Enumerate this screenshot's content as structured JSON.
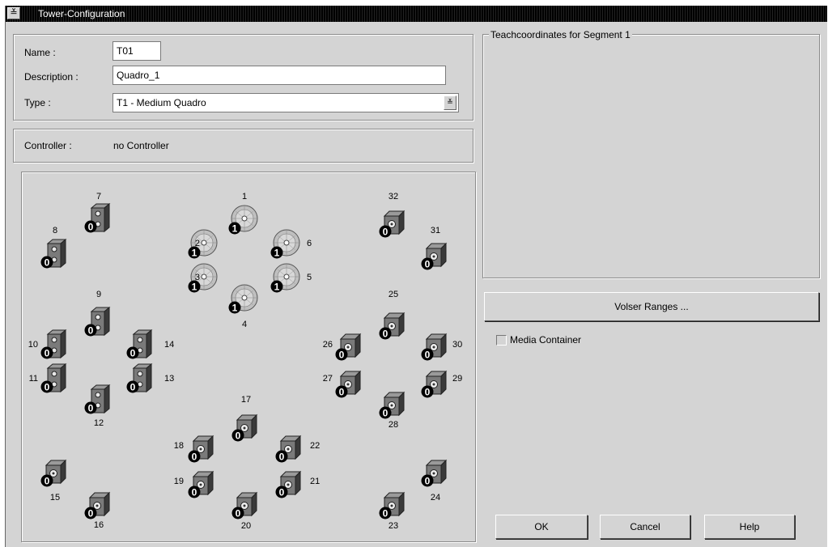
{
  "window": {
    "title": "Tower-Configuration",
    "sysmenu_glyph": "≚"
  },
  "form": {
    "name_label": "Name :",
    "name_value": "T01",
    "description_label": "Description :",
    "description_value": "Quadro_1",
    "type_label": "Type :",
    "type_value": "T1  - Medium Quadro",
    "combo_glyph": "≚"
  },
  "controller": {
    "label": "Controller :",
    "value": "no Controller"
  },
  "teach": {
    "legend": "Teachcoordinates for Segment 1"
  },
  "buttons": {
    "volser": "Volser Ranges ...",
    "ok": "OK",
    "cancel": "Cancel",
    "help": "Help"
  },
  "media_container": {
    "label": "Media Container",
    "checked": false
  },
  "icons": {
    "tape": "tape-drive-icon",
    "cd": "optical-disc-drive-icon"
  },
  "slots": [
    {
      "num": "1",
      "kind": "cd",
      "badge": "1"
    },
    {
      "num": "2",
      "kind": "cd",
      "badge": "1"
    },
    {
      "num": "3",
      "kind": "cd",
      "badge": "1"
    },
    {
      "num": "4",
      "kind": "cd",
      "badge": "1"
    },
    {
      "num": "5",
      "kind": "cd",
      "badge": "1"
    },
    {
      "num": "6",
      "kind": "cd",
      "badge": "1"
    },
    {
      "num": "7",
      "kind": "tall",
      "badge": "0"
    },
    {
      "num": "8",
      "kind": "tall",
      "badge": "0"
    },
    {
      "num": "9",
      "kind": "tall",
      "badge": "0"
    },
    {
      "num": "10",
      "kind": "tall",
      "badge": "0"
    },
    {
      "num": "11",
      "kind": "tall",
      "badge": "0"
    },
    {
      "num": "12",
      "kind": "tall",
      "badge": "0"
    },
    {
      "num": "13",
      "kind": "tall",
      "badge": "0"
    },
    {
      "num": "14",
      "kind": "tall",
      "badge": "0"
    },
    {
      "num": "15",
      "kind": "box",
      "badge": "0"
    },
    {
      "num": "16",
      "kind": "box",
      "badge": "0"
    },
    {
      "num": "17",
      "kind": "box",
      "badge": "0"
    },
    {
      "num": "18",
      "kind": "box",
      "badge": "0"
    },
    {
      "num": "19",
      "kind": "box",
      "badge": "0"
    },
    {
      "num": "20",
      "kind": "box",
      "badge": "0"
    },
    {
      "num": "21",
      "kind": "box",
      "badge": "0"
    },
    {
      "num": "22",
      "kind": "box",
      "badge": "0"
    },
    {
      "num": "23",
      "kind": "box",
      "badge": "0"
    },
    {
      "num": "24",
      "kind": "box",
      "badge": "0"
    },
    {
      "num": "25",
      "kind": "box",
      "badge": "0"
    },
    {
      "num": "26",
      "kind": "box",
      "badge": "0"
    },
    {
      "num": "27",
      "kind": "box",
      "badge": "0"
    },
    {
      "num": "28",
      "kind": "box",
      "badge": "0"
    },
    {
      "num": "29",
      "kind": "box",
      "badge": "0"
    },
    {
      "num": "30",
      "kind": "box",
      "badge": "0"
    },
    {
      "num": "31",
      "kind": "box",
      "badge": "0"
    },
    {
      "num": "32",
      "kind": "box",
      "badge": "0"
    }
  ]
}
